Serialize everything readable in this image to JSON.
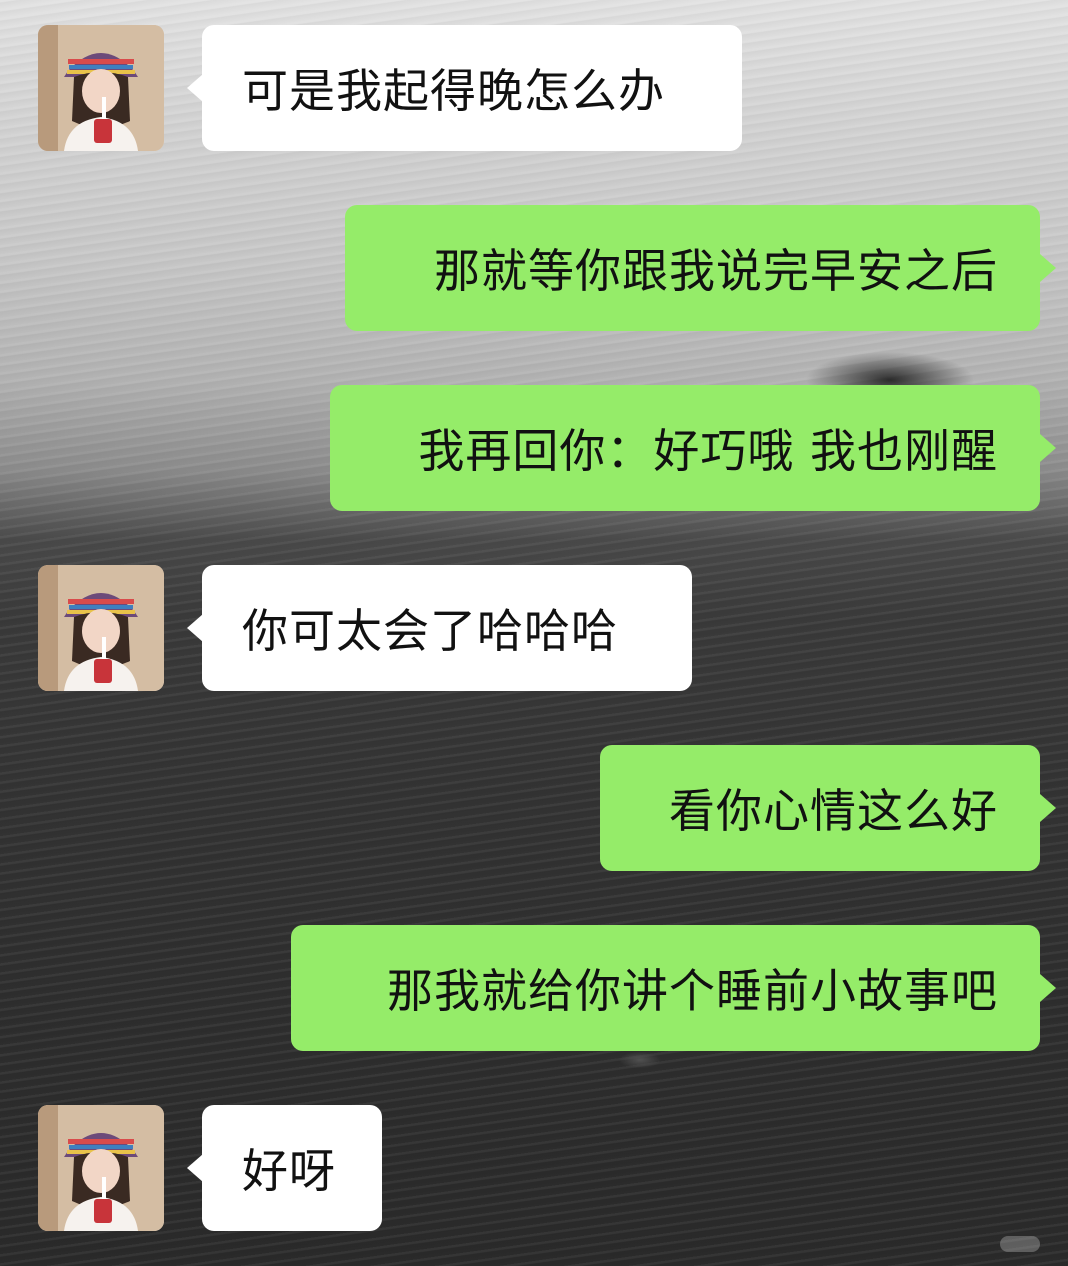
{
  "chat": {
    "contact_avatar": "avatar-girl-with-bucket-hat",
    "colors": {
      "incoming_bubble": "#ffffff",
      "outgoing_bubble": "#95ec69"
    },
    "messages": [
      {
        "side": "incoming",
        "text": "可是我起得晚怎么办"
      },
      {
        "side": "outgoing",
        "text": "那就等你跟我说完早安之后"
      },
      {
        "side": "outgoing",
        "text": "我再回你：好巧哦 我也刚醒"
      },
      {
        "side": "incoming",
        "text": "你可太会了哈哈哈"
      },
      {
        "side": "outgoing",
        "text": "看你心情这么好"
      },
      {
        "side": "outgoing",
        "text": "那我就给你讲个睡前小故事吧"
      },
      {
        "side": "incoming",
        "text": "好呀"
      }
    ]
  }
}
